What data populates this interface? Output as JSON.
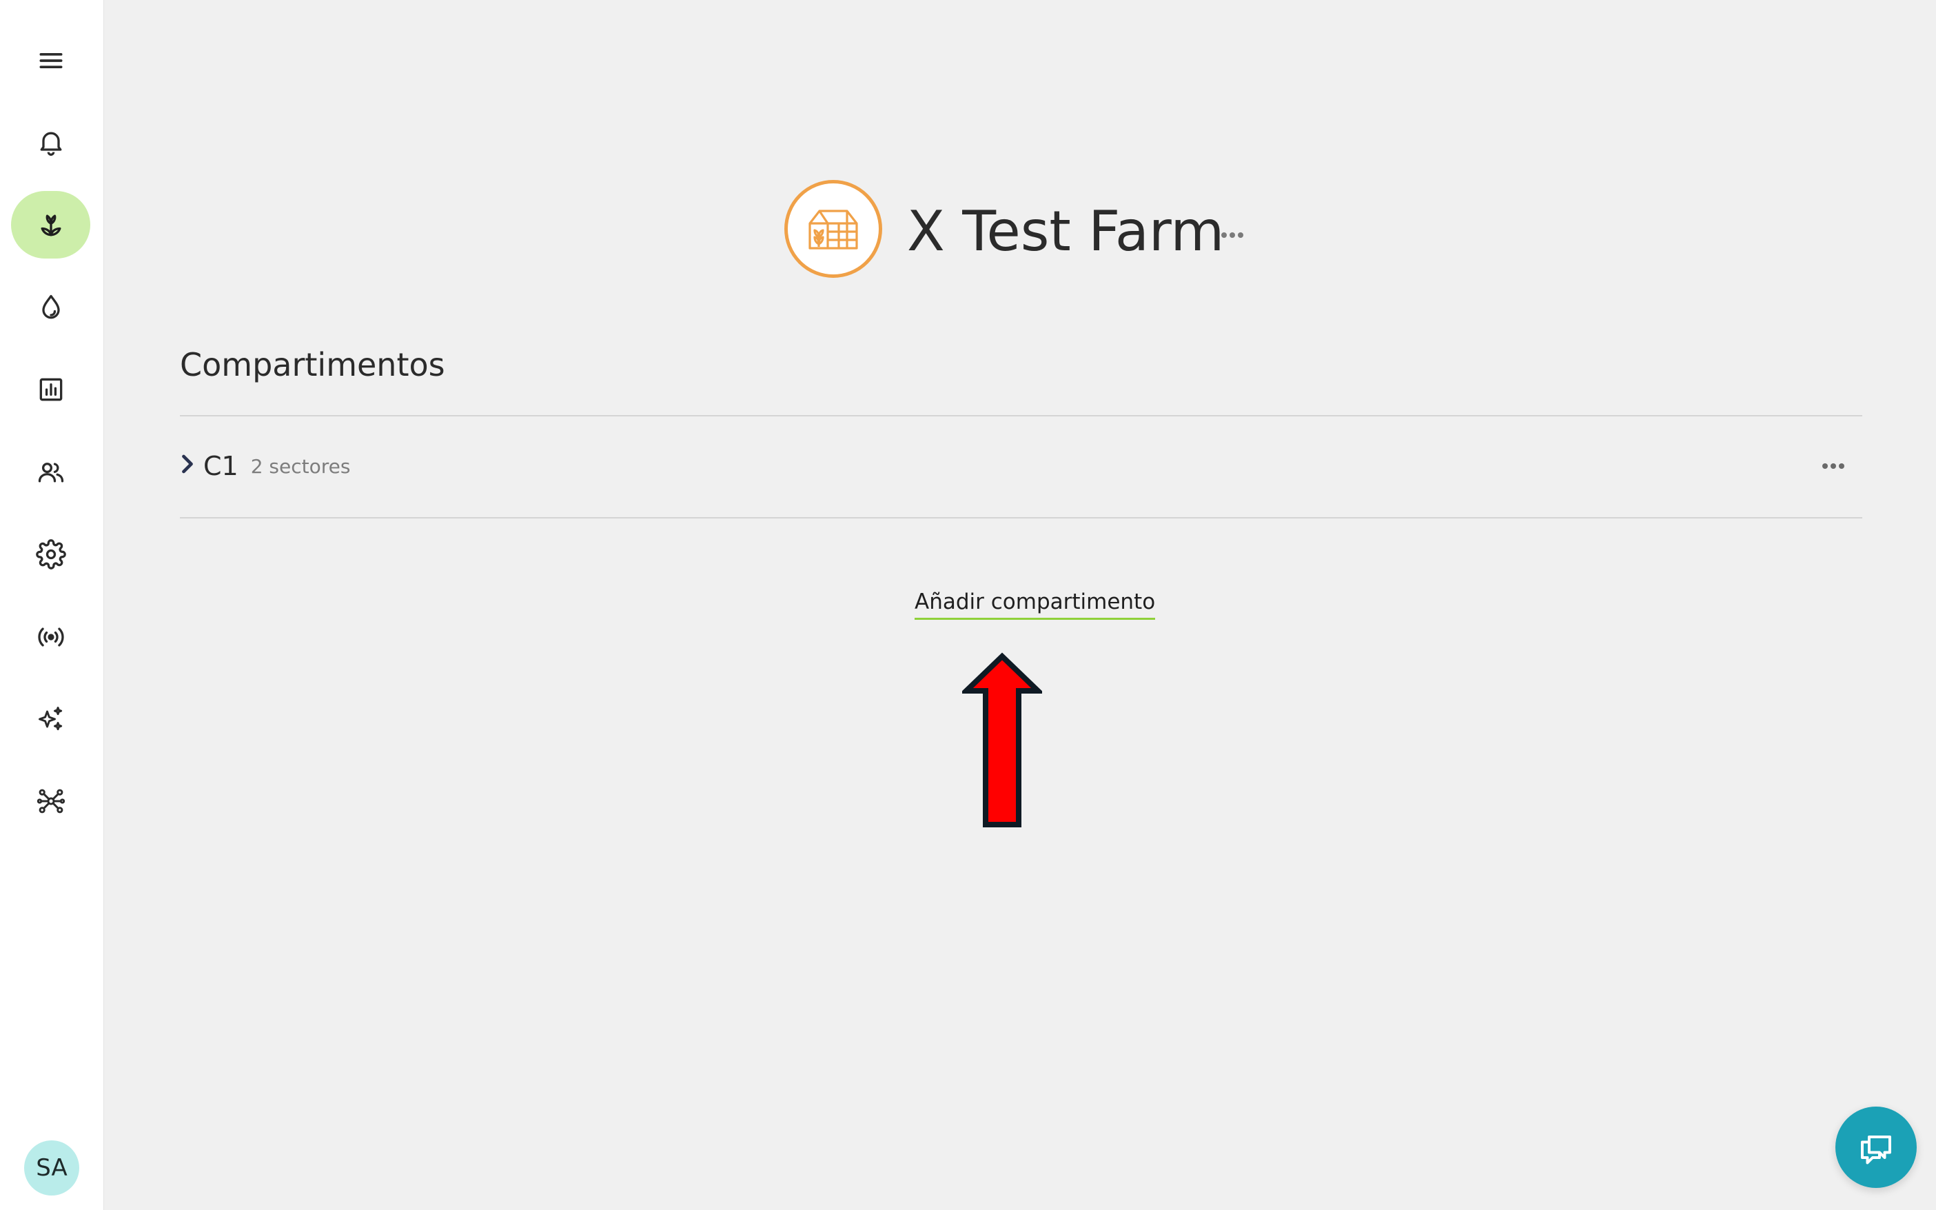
{
  "sidebar": {
    "items": [
      {
        "icon": "menu-icon"
      },
      {
        "icon": "bell-icon"
      },
      {
        "icon": "sprout-icon",
        "active": true
      },
      {
        "icon": "water-drop-icon"
      },
      {
        "icon": "bar-chart-icon"
      },
      {
        "icon": "users-icon"
      },
      {
        "icon": "gear-icon"
      },
      {
        "icon": "broadcast-icon"
      },
      {
        "icon": "sparkles-icon"
      },
      {
        "icon": "network-icon"
      }
    ],
    "active_color": "#cdeeaa",
    "avatar_initials": "SA",
    "avatar_color": "#b9ecea"
  },
  "header": {
    "farm_name": "X Test Farm",
    "logo_icon": "greenhouse-icon",
    "logo_color": "#f0a148"
  },
  "section": {
    "title": "Compartimentos",
    "compartments": [
      {
        "name": "C1",
        "meta": "2 sectores"
      }
    ],
    "add_label": "Añadir compartimento",
    "add_underline_color": "#8fd13a"
  },
  "annotation": {
    "icon": "red-arrow-up",
    "color": "#ff0000"
  },
  "chat": {
    "icon": "chat-bubbles-icon",
    "color": "#1ba1b6"
  }
}
